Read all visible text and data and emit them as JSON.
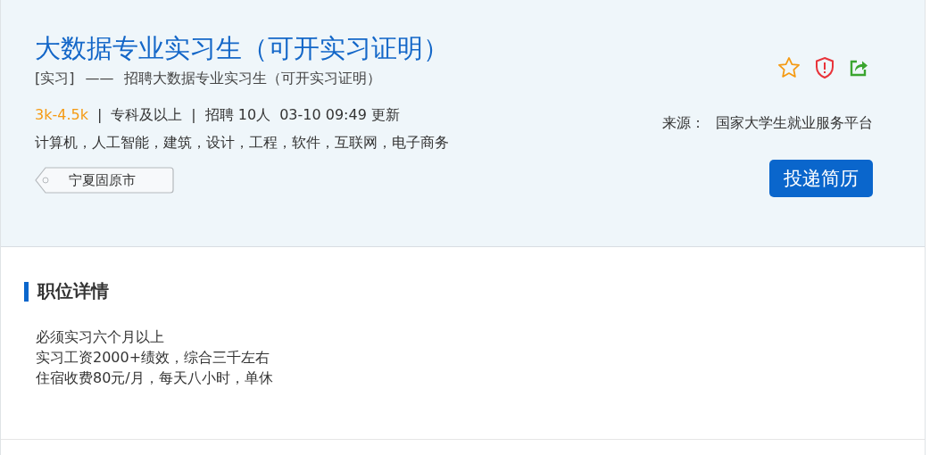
{
  "job": {
    "title": "大数据专业实习生（可开实习证明）",
    "type_tag": "[实习]",
    "dash": "——",
    "subtitle": "招聘大数据专业实习生（可开实习证明）",
    "salary": "3k-4.5k",
    "separator": "|",
    "education": "专科及以上",
    "headcount": "招聘 10人",
    "updated": "03-10 09:49 更新",
    "majors": "计算机，人工智能，建筑，设计，工程，软件，互联网，电子商务",
    "location": "宁夏固原市",
    "source_label": "来源：",
    "source": "国家大学生就业服务平台",
    "apply_button": "投递简历"
  },
  "details": {
    "heading": "职位详情",
    "lines": [
      "必须实习六个月以上",
      "实习工资2000+绩效，综合三千左右",
      "住宿收费80元/月，每天八小时，单休"
    ]
  }
}
